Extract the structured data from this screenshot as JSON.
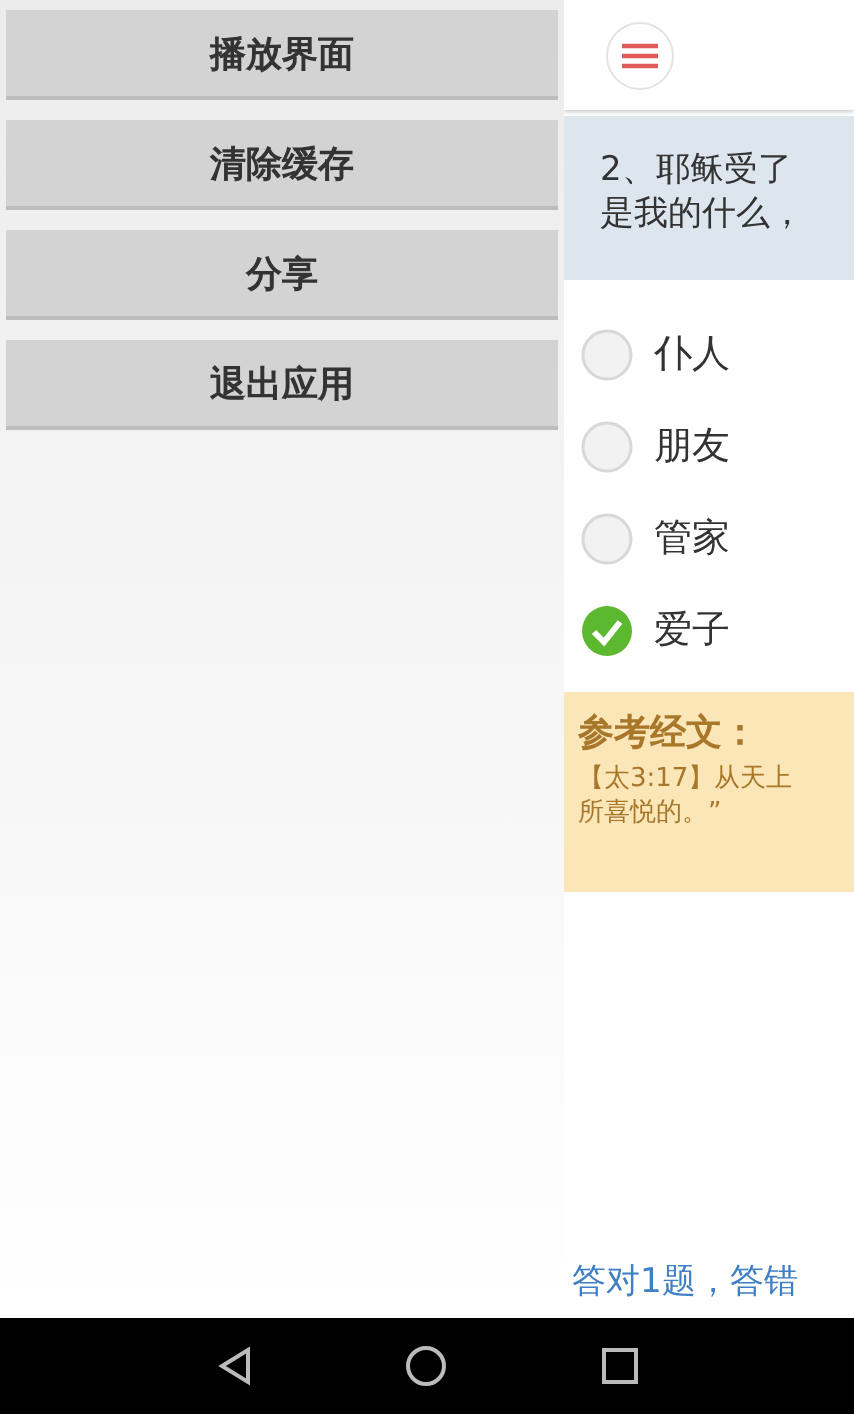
{
  "drawer": {
    "items": [
      {
        "label": "播放界面"
      },
      {
        "label": "清除缓存"
      },
      {
        "label": "分享"
      },
      {
        "label": "退出应用"
      }
    ]
  },
  "question": {
    "lines": [
      "2、耶稣受了",
      "是我的什么，"
    ]
  },
  "options": [
    {
      "label": "仆人",
      "selected": false
    },
    {
      "label": "朋友",
      "selected": false
    },
    {
      "label": "管家",
      "selected": false
    },
    {
      "label": "爱子",
      "selected": true
    }
  ],
  "reference": {
    "title": "参考经文：",
    "lines": [
      "【太3:17】从天上",
      "所喜悦的。”"
    ]
  },
  "footer": {
    "score": "答对1题，答错"
  }
}
